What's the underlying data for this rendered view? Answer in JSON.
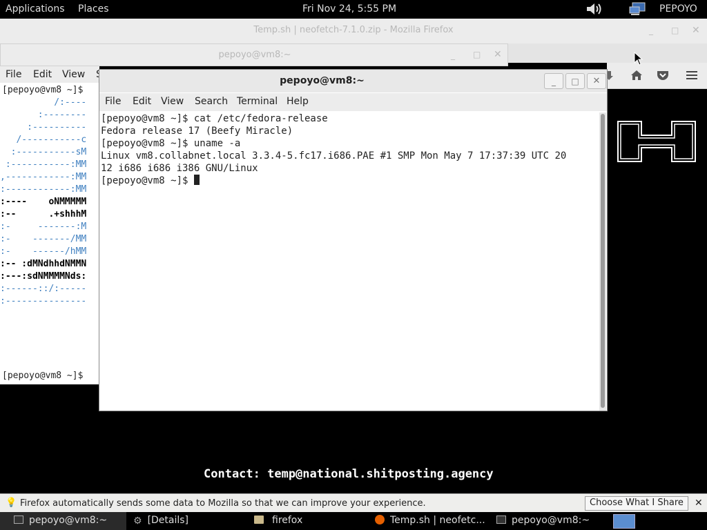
{
  "top_panel": {
    "applications": "Applications",
    "places": "Places",
    "clock": "Fri Nov 24,  5:55 PM",
    "user": "PEPOYO"
  },
  "firefox": {
    "title": "Temp.sh | neofetch-7.1.0.zip - Mozilla Firefox",
    "contact": "Contact: temp@national.shitposting.agency",
    "notification": "Firefox automatically sends some data to Mozilla so that we can improve your experience.",
    "notification_button": "Choose What I Share"
  },
  "back_terminal": {
    "title": "pepoyo@vm8:~",
    "menu": [
      "File",
      "Edit",
      "View",
      "S"
    ],
    "prompt_top": "[pepoyo@vm8 ~]$",
    "logo_lines": [
      "          /:----",
      "       :--------",
      "     :----------",
      "   /-----------c",
      "  :-----------sM",
      " :-----------:MM",
      ",------------:MM",
      ":------------:MM",
      ":----    oNMMMMM",
      ":--      .+shhhM",
      ":-     -------:M",
      ":-    -------/MM",
      ":-    ------/hMM",
      ":-- :dMNdhhdNMMN",
      ":---:sdNMMMMNds:",
      ":------::/:-----",
      ":---------------"
    ],
    "prompt_bottom": "[pepoyo@vm8 ~]$"
  },
  "front_terminal": {
    "title": "pepoyo@vm8:~",
    "menu": [
      "File",
      "Edit",
      "View",
      "Search",
      "Terminal",
      "Help"
    ],
    "lines": [
      "[pepoyo@vm8 ~]$ cat /etc/fedora-release",
      "Fedora release 17 (Beefy Miracle)",
      "[pepoyo@vm8 ~]$ uname -a",
      "Linux vm8.collabnet.local 3.3.4-5.fc17.i686.PAE #1 SMP Mon May 7 17:37:39 UTC 20",
      "12 i686 i686 i386 GNU/Linux"
    ],
    "prompt": "[pepoyo@vm8 ~]$ "
  },
  "taskbar": {
    "items": [
      {
        "label": "pepoyo@vm8:~",
        "icon": "terminal-icon"
      },
      {
        "label": "[Details]",
        "icon": "gear-icon"
      },
      {
        "label": "firefox",
        "icon": "folder-icon"
      },
      {
        "label": "Temp.sh | neofetc...",
        "icon": "firefox-icon"
      },
      {
        "label": "pepoyo@vm8:~",
        "icon": "terminal-icon"
      }
    ]
  },
  "colors": {
    "logo_blue": "#4080c0",
    "panel_bg": "#000000"
  }
}
